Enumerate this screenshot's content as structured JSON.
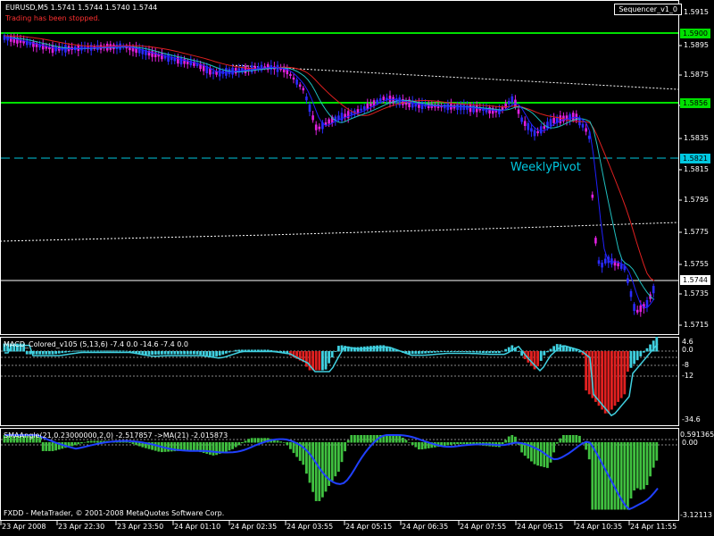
{
  "window": {
    "symbol_line": "EURUSD,M5  1.5741 1.5744 1.5740 1.5744",
    "status_text": "Trading has been stopped.",
    "expert_name": "Sequencer_v1_0",
    "copyright": "FXDD - MetaTrader, © 2001-2008 MetaQuotes Software Corp."
  },
  "colors": {
    "background": "#000000",
    "bull_candle": "#2b2bff",
    "bear_candle": "#e020e0",
    "level_line": "#00e000",
    "pivot_line": "#00c8e0",
    "bid_line": "#ffffff",
    "ma_red": "#e02020",
    "ma_cyan": "#20c0c0",
    "ma_blue": "#2020ff",
    "macd_red": "#e02020",
    "macd_cyan": "#40d0e0",
    "sma_green": "#40c040",
    "sma_ma": "#2040ff"
  },
  "main_chart": {
    "price_axis": [
      "1.5915",
      "1.5895",
      "1.5875",
      "1.5855",
      "1.5835",
      "1.5815",
      "1.5795",
      "1.5775",
      "1.5755",
      "1.5735",
      "1.5715"
    ],
    "price_tags": [
      {
        "text": "1.5900",
        "kind": "level"
      },
      {
        "text": "1.5856",
        "kind": "level"
      },
      {
        "text": "1.5821",
        "kind": "pivot"
      },
      {
        "text": "1.5744",
        "kind": "bid"
      }
    ],
    "pivot_label": "WeeklyPivot"
  },
  "macd": {
    "title": "MACD_Colored_v105 (5,13,6) -7.4 0.0 -14.6 -7.4 0.0",
    "axis": [
      "4.6",
      "0.0",
      "-8",
      "-12",
      "-34.6"
    ]
  },
  "sma_angle": {
    "title": "SMAAngle(21,0.23000000,2,0) -2.517857  ->MA(21) -2.015873",
    "axis": [
      "0.591365",
      "0.00",
      "-3.12113"
    ]
  },
  "time_axis": [
    "23 Apr 2008",
    "23 Apr 22:30",
    "23 Apr 23:50",
    "24 Apr 01:10",
    "24 Apr 02:35",
    "24 Apr 03:55",
    "24 Apr 05:15",
    "24 Apr 06:35",
    "24 Apr 07:55",
    "24 Apr 09:15",
    "24 Apr 10:35",
    "24 Apr 11:55"
  ]
}
